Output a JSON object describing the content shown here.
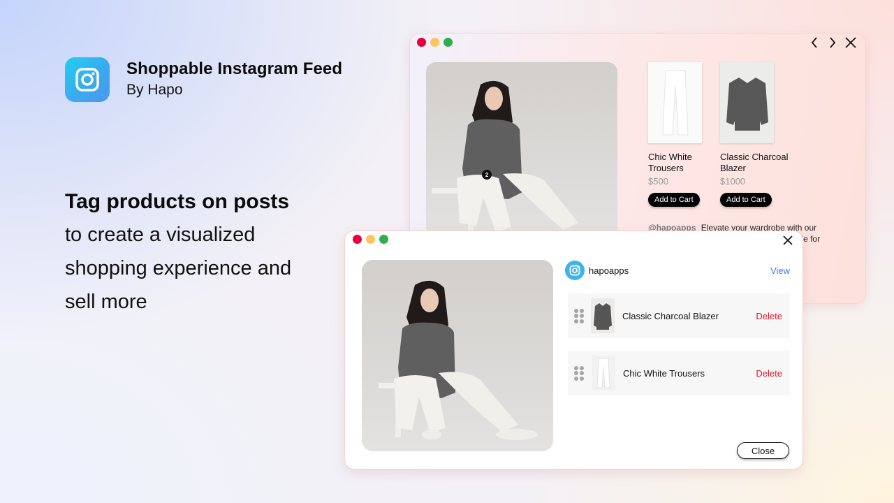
{
  "brand": {
    "title": "Shoppable Instagram Feed",
    "subtitle": "By Hapo",
    "icon": "instagram-icon",
    "icon_gradient": [
      "#1fd0ee",
      "#4d97ec"
    ]
  },
  "tagline": {
    "headline": "Tag products on posts",
    "lines": [
      "to create a visualized",
      "shopping experience and",
      "sell more"
    ]
  },
  "popup_window": {
    "window_controls": [
      "close",
      "minimize",
      "maximize"
    ],
    "nav": {
      "prev_icon": "chevron-left-icon",
      "next_icon": "chevron-right-icon",
      "close_icon": "close-icon"
    },
    "photo_tag_number": "2",
    "products": [
      {
        "name": "Chic White Trousers",
        "price": "$500",
        "button": "Add to Cart"
      },
      {
        "name": "Classic Charcoal Blazer",
        "price": "$1000",
        "button": "Add to Cart"
      }
    ],
    "caption": {
      "handle": "@hapoapps",
      "text": "Elevate your wardrobe with our classic charcoal blazer — a timeless staple for every occasion."
    }
  },
  "tag_editor": {
    "account": {
      "name": "hapoapps",
      "view_label": "View"
    },
    "tagged_products": [
      {
        "name": "Classic Charcoal Blazer",
        "action": "Delete"
      },
      {
        "name": "Chic White Trousers",
        "action": "Delete"
      }
    ],
    "close_label": "Close"
  },
  "colors": {
    "delete": "#e0162b",
    "link": "#3b7bec",
    "dot_red": "#e6003e",
    "dot_yellow": "#fec55e",
    "dot_green": "#2fae4e",
    "button_dark": "#000000"
  }
}
